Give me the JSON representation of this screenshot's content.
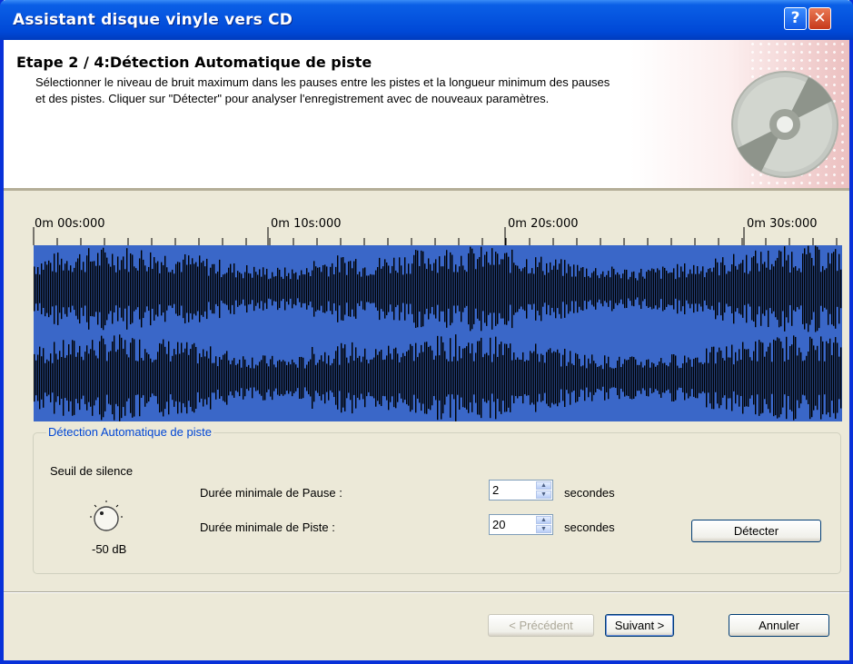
{
  "window": {
    "title": "Assistant disque vinyle vers CD",
    "help_glyph": "?",
    "close_glyph": "✕"
  },
  "header": {
    "step_title": "Etape 2 / 4:Détection Automatique de piste",
    "description": "Sélectionner le niveau de bruit maximum dans les pauses entre les pistes et la longueur minimum des pauses et des pistes. Cliquer sur \"Détecter\" pour analyser l'enregistrement avec de nouveaux paramètres."
  },
  "timeline": {
    "ticks": [
      "0m 00s:000",
      "0m 10s:000",
      "0m 20s:000",
      "0m 30s:000"
    ]
  },
  "detection": {
    "group_label": "Détection Automatique de piste",
    "silence_threshold_label": "Seuil de silence",
    "knob_value": "-50 dB",
    "min_pause_label": "Durée minimale de Pause :",
    "min_pause_value": "2",
    "min_track_label": "Durée minimale de Piste :",
    "min_track_value": "20",
    "unit_label": "secondes",
    "detect_button": "Détecter"
  },
  "footer": {
    "previous_button": "< Précédent",
    "next_button": "Suivant >",
    "cancel_button": "Annuler"
  },
  "colors": {
    "title_bar": "#0054e3",
    "wave_background": "#3a67c8",
    "wave_foreground": "#000000",
    "group_label": "#0046d5"
  }
}
